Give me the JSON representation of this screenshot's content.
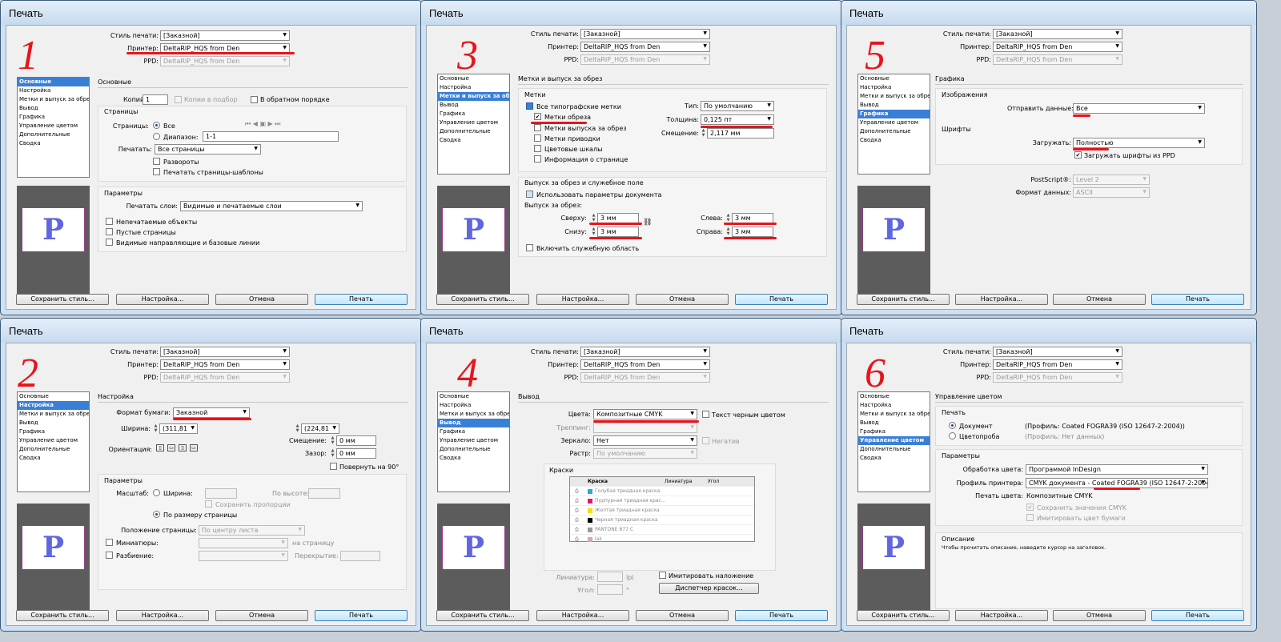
{
  "common": {
    "dialog_title": "Печать",
    "print_style_label": "Стиль печати:",
    "print_style_value": "[Заказной]",
    "printer_label": "Принтер:",
    "printer_value": "DeltaRIP_HQS from Den",
    "ppd_label": "PPD:",
    "ppd_value": "DeltaRIP_HQS from Den",
    "btn_save": "Сохранить стиль...",
    "btn_setup": "Настройка...",
    "btn_cancel": "Отмена",
    "btn_print": "Печать",
    "preview_letter": "P",
    "red_annotation_color": "#e8141b",
    "selected_item_color": "#3a7fd6"
  },
  "nav_items": [
    "Основные",
    "Настройка",
    "Метки и выпуск за обрез",
    "Вывод",
    "Графика",
    "Управление цветом",
    "Дополнительные",
    "Сводка"
  ],
  "panels": [
    {
      "number": "1",
      "section_title": "Основные",
      "copies_label": "Копий:",
      "copies_value": "1",
      "collate_label": "Копии в подбор",
      "reverse_label": "В обратном порядке",
      "pages_group": "Страницы",
      "pages_label": "Страницы:",
      "all_label": "Все",
      "range_label": "Диапазон:",
      "range_value": "1-1",
      "print_label": "Печатать:",
      "print_value": "Все страницы",
      "spreads_label": "Развороты",
      "masters_label": "Печатать страницы-шаблоны",
      "params_group": "Параметры",
      "layers_label": "Печатать слои:",
      "layers_value": "Видимые и печатаемые слои",
      "nonprint_label": "Непечатаемые объекты",
      "blank_label": "Пустые страницы",
      "guides_label": "Видимые направляющие и базовые линии"
    },
    {
      "number": "2",
      "section_title": "Настройка",
      "paper_label": "Формат бумаги:",
      "paper_value": "Заказной",
      "width_label": "Ширина:",
      "width_value": "(311,81",
      "height_value": "(224,81",
      "orientation_label": "Ориентация:",
      "offset_label": "Смещение:",
      "offset_value": "0 мм",
      "gap_label": "Зазор:",
      "gap_value": "0 мм",
      "rotate_label": "Повернуть на 90°",
      "params_group": "Параметры",
      "scale_label": "Масштаб:",
      "scale_width_label": "Ширина:",
      "scale_height_label": "По высоте:",
      "keep_prop_label": "Сохранить пропорции",
      "fit_label": "По размеру страницы",
      "position_label": "Положение страницы:",
      "position_value": "По центру листа",
      "thumbs_label": "Миниатюры:",
      "per_page_label": "на страницу",
      "tile_label": "Разбиение:",
      "overlap_label": "Перекрытие:"
    },
    {
      "number": "3",
      "section_title": "Метки и выпуск за обрез",
      "marks_group": "Метки",
      "all_marks_label": "Все типографские метки",
      "crop_label": "Метки обреза",
      "bleed_marks_label": "Метки выпуска за обрез",
      "reg_label": "Метки приводки",
      "color_bars_label": "Цветовые шкалы",
      "page_info_label": "Информация о странице",
      "type_label": "Тип:",
      "type_value": "По умолчанию",
      "weight_label": "Толщина:",
      "weight_value": "0,125 пт",
      "offset_label": "Смещение:",
      "offset_value": "2,117 мм",
      "bleed_group": "Выпуск за обрез и служебное поле",
      "use_doc_label": "Использовать параметры документа",
      "bleed_label": "Выпуск за обрез:",
      "top_label": "Сверху:",
      "top_value": "3 мм",
      "bottom_label": "Снизу:",
      "bottom_value": "3 мм",
      "left_label": "Слева:",
      "left_value": "3 мм",
      "right_label": "Справа:",
      "right_value": "3 мм",
      "slug_label": "Включить служебную область"
    },
    {
      "number": "4",
      "section_title": "Вывод",
      "color_label": "Цвета:",
      "color_value": "Композитные CMYK",
      "black_text_label": "Текст черным цветом",
      "trap_label": "Треппинг:",
      "mirror_label": "Зеркало:",
      "mirror_value": "Нет",
      "negative_label": "Негатив",
      "screen_label": "Растр:",
      "screen_value": "По умолчанию",
      "inks_group": "Краски",
      "col_ink": "Краска",
      "col_freq": "Линиатура",
      "col_angle": "Угол",
      "inks": [
        {
          "name": "Голубая триадная краска",
          "color": "#29a8e0"
        },
        {
          "name": "Пурпурная триадная крас...",
          "color": "#e0157a"
        },
        {
          "name": "Желтая триадная краска",
          "color": "#f5e000"
        },
        {
          "name": "Черная триадная краска",
          "color": "#000000"
        },
        {
          "name": "PANTONE 877 C",
          "color": "#999999"
        },
        {
          "name": "lak",
          "color": "#d9a0c8"
        }
      ],
      "freq_label": "Линиатура:",
      "freq_unit": "lpi",
      "angle_label": "Угол:",
      "angle_unit": "°",
      "simulate_label": "Имитировать наложение",
      "ink_mgr_label": "Диспетчер красок..."
    },
    {
      "number": "5",
      "section_title": "Графика",
      "images_group": "Изображения",
      "send_label": "Отправить данные:",
      "send_value": "Все",
      "fonts_group": "Шрифты",
      "download_label": "Загружать:",
      "download_value": "Полностью",
      "ppd_fonts_label": "Загружать шрифты из PPD",
      "postscript_label": "PostScript®:",
      "postscript_value": "Level 2",
      "format_label": "Формат данных:",
      "format_value": "ASCII"
    },
    {
      "number": "6",
      "section_title": "Управление цветом",
      "print_group": "Печать",
      "doc_label": "Документ",
      "doc_profile": "(Профиль: Coated FOGRA39 (ISO 12647-2:2004))",
      "proof_label": "Цветопроба",
      "proof_profile": "(Профиль: Нет данных)",
      "params_group": "Параметры",
      "handling_label": "Обработка цвета:",
      "handling_value": "Программой InDesign",
      "profile_label": "Профиль принтера:",
      "profile_value": "CMYK документа - Coated FOGRA39 (ISO 12647-2:2004)",
      "output_label": "Печать цвета:",
      "output_value": "Композитные CMYK",
      "preserve_label": "Сохранить значения CMYK",
      "simulate_paper_label": "Имитировать цвет бумаги",
      "desc_group": "Описание",
      "desc_text": "Чтобы прочитать описание, наведите курсор на заголовок."
    }
  ]
}
